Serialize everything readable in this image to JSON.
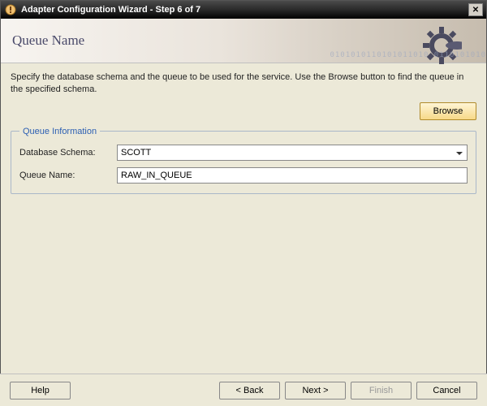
{
  "window": {
    "title": "Adapter Configuration Wizard - Step 6 of 7"
  },
  "header": {
    "page_title": "Queue Name",
    "binary_deco": "0101010110101011010 0110101010"
  },
  "intro_text": "Specify the database schema and the queue to be used for the service. Use the Browse button to find the queue in the specified schema.",
  "browse_label": "Browse",
  "group": {
    "legend": "Queue Information",
    "schema_label": "Database Schema:",
    "schema_value": "SCOTT",
    "queue_label": "Queue Name:",
    "queue_value": "RAW_IN_QUEUE"
  },
  "footer": {
    "help": "Help",
    "back": "< Back",
    "next": "Next >",
    "finish": "Finish",
    "cancel": "Cancel"
  }
}
